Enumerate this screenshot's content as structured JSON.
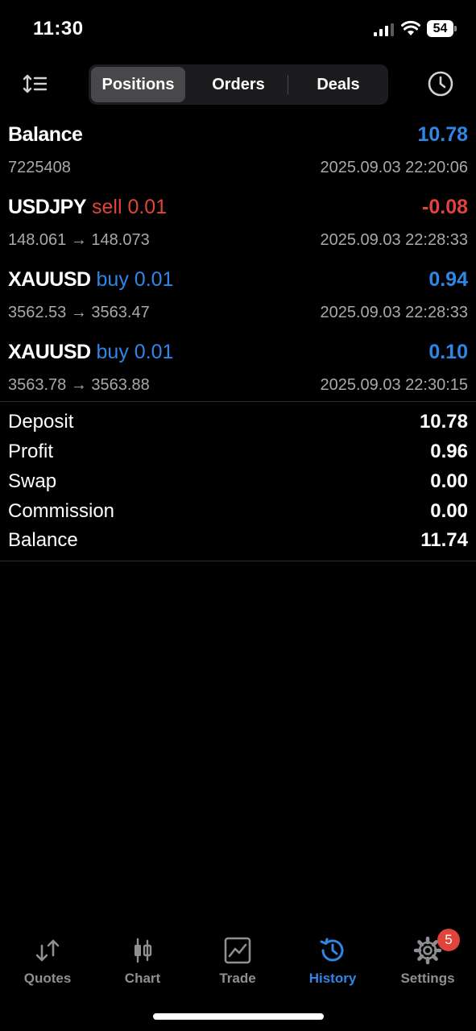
{
  "status_bar": {
    "time": "11:30",
    "battery": "54"
  },
  "toolbar": {
    "segments": [
      "Positions",
      "Orders",
      "Deals"
    ],
    "active_segment": "Positions"
  },
  "rows": [
    {
      "symbol": "Balance",
      "side": "",
      "value": "10.78",
      "value_color": "#2e86e6",
      "detail": "7225408",
      "datetime": "2025.09.03 22:20:06"
    },
    {
      "symbol": "USDJPY",
      "side": "sell 0.01",
      "value": "-0.08",
      "value_color": "#e0443a",
      "detail": "148.061 → 148.073",
      "datetime": "2025.09.03 22:28:33"
    },
    {
      "symbol": "XAUUSD",
      "side": "buy 0.01",
      "value": "0.94",
      "value_color": "#2e86e6",
      "detail": "3562.53 → 3563.47",
      "datetime": "2025.09.03 22:28:33"
    },
    {
      "symbol": "XAUUSD",
      "side": "buy 0.01",
      "value": "0.10",
      "value_color": "#2e86e6",
      "detail": "3563.78 → 3563.88",
      "datetime": "2025.09.03 22:30:15"
    }
  ],
  "summary": [
    {
      "label": "Deposit",
      "value": "10.78"
    },
    {
      "label": "Profit",
      "value": "0.96"
    },
    {
      "label": "Swap",
      "value": "0.00"
    },
    {
      "label": "Commission",
      "value": "0.00"
    },
    {
      "label": "Balance",
      "value": "11.74"
    }
  ],
  "tabs": [
    {
      "label": "Quotes",
      "icon": "quotes-icon"
    },
    {
      "label": "Chart",
      "icon": "chart-icon"
    },
    {
      "label": "Trade",
      "icon": "trade-icon"
    },
    {
      "label": "History",
      "icon": "history-icon",
      "active": true
    },
    {
      "label": "Settings",
      "icon": "settings-icon",
      "badge": "5"
    }
  ],
  "colors": {
    "accent": "#2e86e6",
    "loss": "#e0443a",
    "secondary_text": "#a8a8ad",
    "background": "#000000"
  }
}
